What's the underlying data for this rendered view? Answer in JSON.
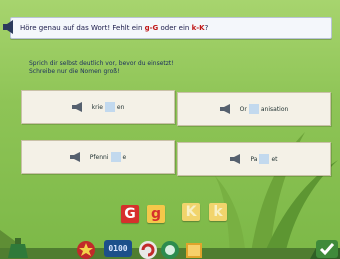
{
  "header": {
    "text_before": "Höre genau auf das Wort! Fehlt ein ",
    "option1": "g-G",
    "text_middle": " oder ein ",
    "option2": "k-K",
    "text_after": "?"
  },
  "instructions": {
    "line1": "Sprich dir selbst deutlich vor, bevor du einsetzt!",
    "line2": "Schreibe nur die Nomen groß!"
  },
  "cards": [
    {
      "before": "krie",
      "after": "en"
    },
    {
      "before": "Or",
      "after": "anisation"
    },
    {
      "before": "Pfenni",
      "after": "e"
    },
    {
      "before": "Pa",
      "after": "et"
    }
  ],
  "letters": [
    "G",
    "g",
    "K",
    "k"
  ],
  "timer": "0100",
  "colors": {
    "background": "#8ec456",
    "card": "#f4f1e7",
    "gap": "#c2d9ee",
    "accent_red": "#d6302c",
    "accent_yellow": "#f1d46c"
  }
}
